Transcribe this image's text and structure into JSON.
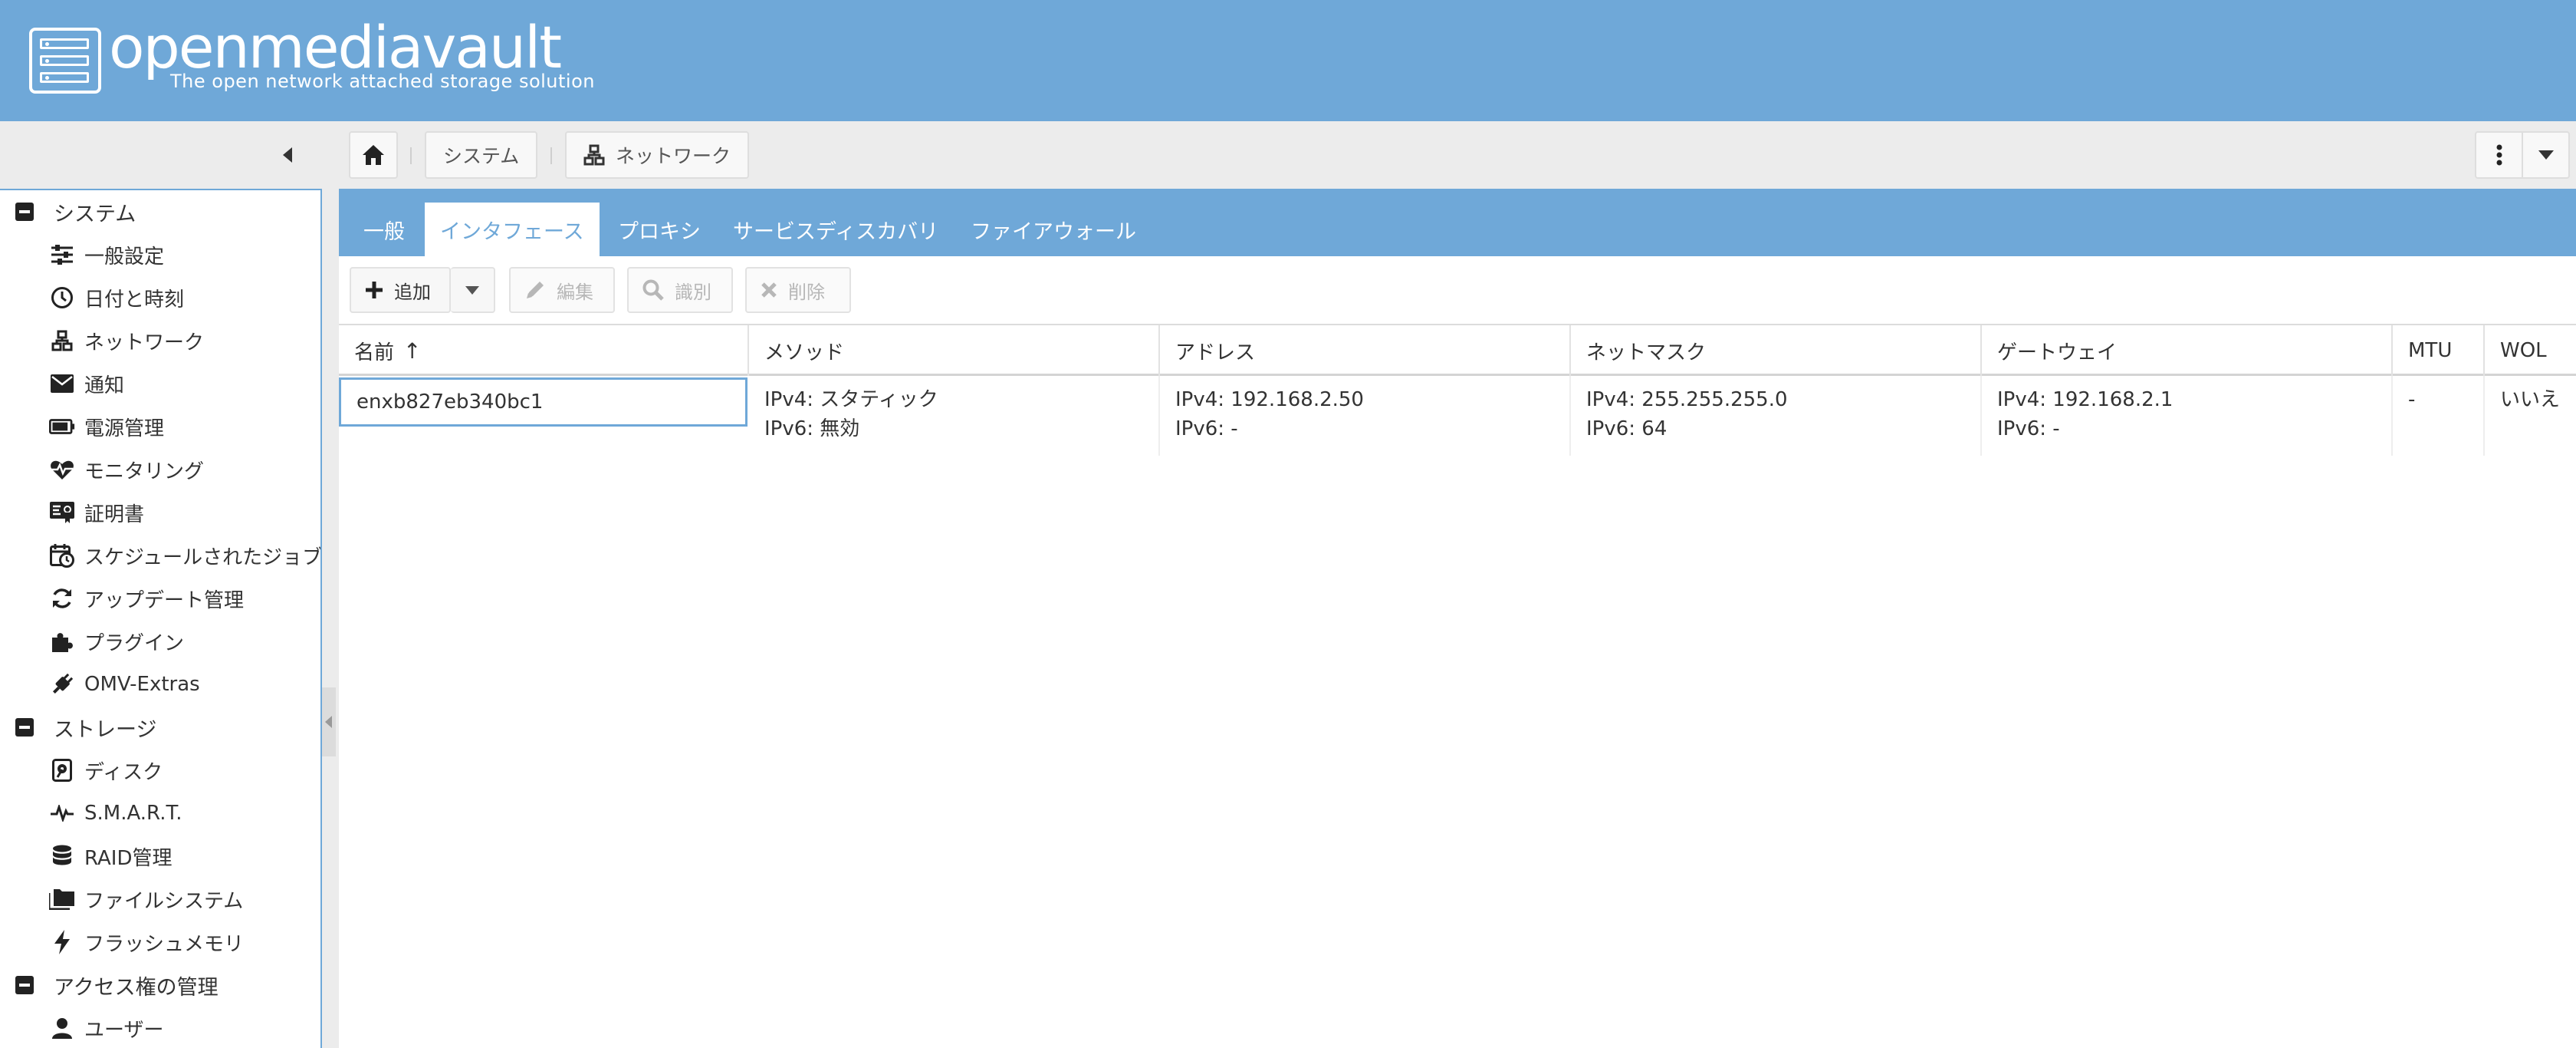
{
  "app": {
    "title": "openmediavault",
    "subtitle": "The open network attached storage solution"
  },
  "breadcrumb": {
    "items": [
      "システム",
      "ネットワーク"
    ]
  },
  "sidebar": {
    "groups": [
      {
        "label": "システム",
        "items": [
          {
            "label": "一般設定",
            "icon": "sliders-icon"
          },
          {
            "label": "日付と時刻",
            "icon": "clock-icon"
          },
          {
            "label": "ネットワーク",
            "icon": "network-icon"
          },
          {
            "label": "通知",
            "icon": "envelope-icon"
          },
          {
            "label": "電源管理",
            "icon": "battery-icon"
          },
          {
            "label": "モニタリング",
            "icon": "heartbeat-icon"
          },
          {
            "label": "証明書",
            "icon": "certificate-icon"
          },
          {
            "label": "スケジュールされたジョブ",
            "icon": "calendar-clock-icon"
          },
          {
            "label": "アップデート管理",
            "icon": "refresh-icon"
          },
          {
            "label": "プラグイン",
            "icon": "puzzle-icon"
          },
          {
            "label": "OMV-Extras",
            "icon": "plug-icon"
          }
        ]
      },
      {
        "label": "ストレージ",
        "items": [
          {
            "label": "ディスク",
            "icon": "disk-icon"
          },
          {
            "label": "S.M.A.R.T.",
            "icon": "pulse-icon"
          },
          {
            "label": "RAID管理",
            "icon": "database-icon"
          },
          {
            "label": "ファイルシステム",
            "icon": "folders-icon"
          },
          {
            "label": "フラッシュメモリ",
            "icon": "bolt-icon"
          }
        ]
      },
      {
        "label": "アクセス権の管理",
        "items": [
          {
            "label": "ユーザー",
            "icon": "user-icon"
          }
        ]
      }
    ]
  },
  "tabs": [
    "一般",
    "インタフェース",
    "プロキシ",
    "サービスディスカバリ",
    "ファイアウォール"
  ],
  "active_tab": "インタフェース",
  "toolbar": {
    "add": "追加",
    "edit": "編集",
    "identify": "識別",
    "delete": "削除"
  },
  "grid": {
    "columns": [
      "名前",
      "メソッド",
      "アドレス",
      "ネットマスク",
      "ゲートウェイ",
      "MTU",
      "WOL"
    ],
    "sort_indicator": "↑",
    "rows": [
      {
        "name": "enxb827eb340bc1",
        "method": [
          "IPv4: スタティック",
          "IPv6: 無効"
        ],
        "address": [
          "IPv4: 192.168.2.50",
          "IPv6: -"
        ],
        "netmask": [
          "IPv4: 255.255.255.0",
          "IPv6: 64"
        ],
        "gateway": [
          "IPv4: 192.168.2.1",
          "IPv6: -"
        ],
        "mtu": "-",
        "wol": "いいえ"
      }
    ]
  },
  "colors": {
    "accent": "#6fa8d8",
    "header_bg": "#6fa8d8",
    "toolbar_bg": "#ececec"
  }
}
